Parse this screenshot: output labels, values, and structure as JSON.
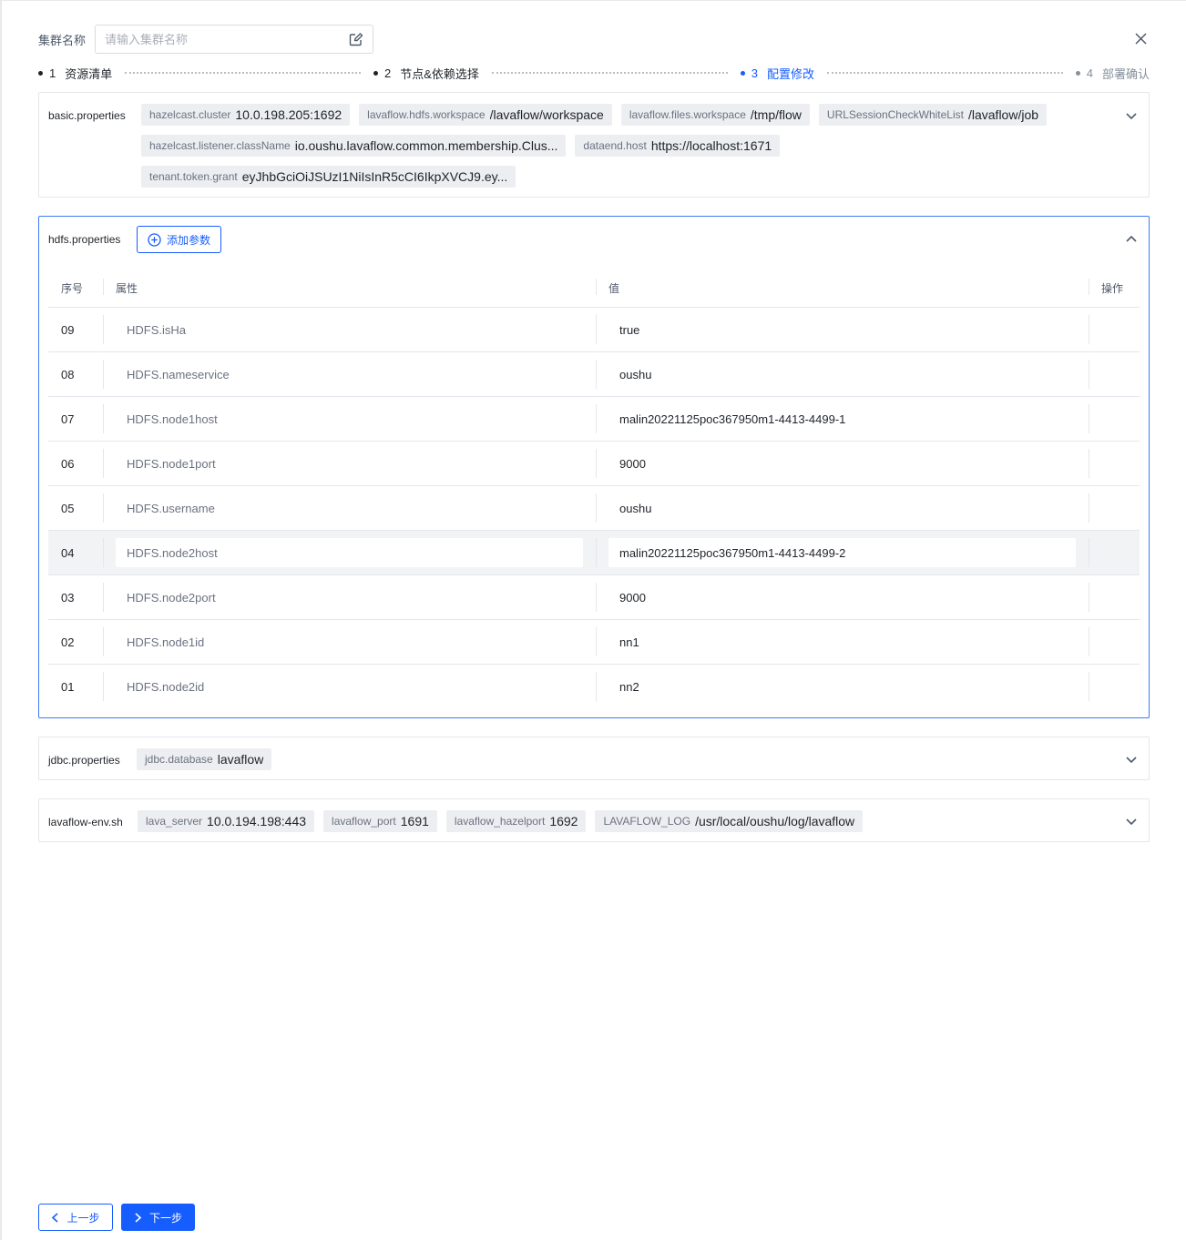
{
  "header": {
    "cluster_name_label": "集群名称",
    "cluster_name_placeholder": "请输入集群名称",
    "cluster_name_value": ""
  },
  "steps": [
    {
      "num": "1",
      "label": "资源清单",
      "state": "done"
    },
    {
      "num": "2",
      "label": "节点&依赖选择",
      "state": "done"
    },
    {
      "num": "3",
      "label": "配置修改",
      "state": "active"
    },
    {
      "num": "4",
      "label": "部署确认",
      "state": "pending"
    }
  ],
  "basic": {
    "title": "basic.properties",
    "tags": [
      {
        "k": "hazelcast.cluster",
        "v": "10.0.198.205:1692"
      },
      {
        "k": "lavaflow.hdfs.workspace",
        "v": "/lavaflow/workspace"
      },
      {
        "k": "lavaflow.files.workspace",
        "v": "/tmp/flow"
      },
      {
        "k": "URLSessionCheckWhiteList",
        "v": "/lavaflow/job"
      },
      {
        "k": "hazelcast.listener.className",
        "v": "io.oushu.lavaflow.common.membership.Clus..."
      },
      {
        "k": "dataend.host",
        "v": "https://localhost:1671"
      },
      {
        "k": "tenant.token.grant",
        "v": "eyJhbGciOiJSUzI1NiIsInR5cCI6IkpXVCJ9.ey..."
      }
    ]
  },
  "hdfs": {
    "title": "hdfs.properties",
    "add_param_label": "添加参数",
    "columns": {
      "index": "序号",
      "attr": "属性",
      "value": "值",
      "op": "操作"
    },
    "rows": [
      {
        "idx": "09",
        "attr": "HDFS.isHa",
        "value": "true"
      },
      {
        "idx": "08",
        "attr": "HDFS.nameservice",
        "value": "oushu"
      },
      {
        "idx": "07",
        "attr": "HDFS.node1host",
        "value": "malin20221125poc367950m1-4413-4499-1"
      },
      {
        "idx": "06",
        "attr": "HDFS.node1port",
        "value": "9000"
      },
      {
        "idx": "05",
        "attr": "HDFS.username",
        "value": "oushu"
      },
      {
        "idx": "04",
        "attr": "HDFS.node2host",
        "value": "malin20221125poc367950m1-4413-4499-2"
      },
      {
        "idx": "03",
        "attr": "HDFS.node2port",
        "value": "9000"
      },
      {
        "idx": "02",
        "attr": "HDFS.node1id",
        "value": "nn1"
      },
      {
        "idx": "01",
        "attr": "HDFS.node2id",
        "value": "nn2"
      }
    ]
  },
  "jdbc": {
    "title": "jdbc.properties",
    "tags": [
      {
        "k": "jdbc.database",
        "v": "lavaflow"
      }
    ]
  },
  "env": {
    "title": "lavaflow-env.sh",
    "tags": [
      {
        "k": "lava_server",
        "v": "10.0.194.198:443"
      },
      {
        "k": "lavaflow_port",
        "v": "1691"
      },
      {
        "k": "lavaflow_hazelport",
        "v": "1692"
      },
      {
        "k": "LAVAFLOW_LOG",
        "v": "/usr/local/oushu/log/lavaflow"
      }
    ]
  },
  "footer": {
    "prev_label": "上一步",
    "next_label": "下一步"
  },
  "colors": {
    "primary": "#165dff",
    "tag_bg": "#eceef1",
    "border": "#e5e6eb"
  }
}
